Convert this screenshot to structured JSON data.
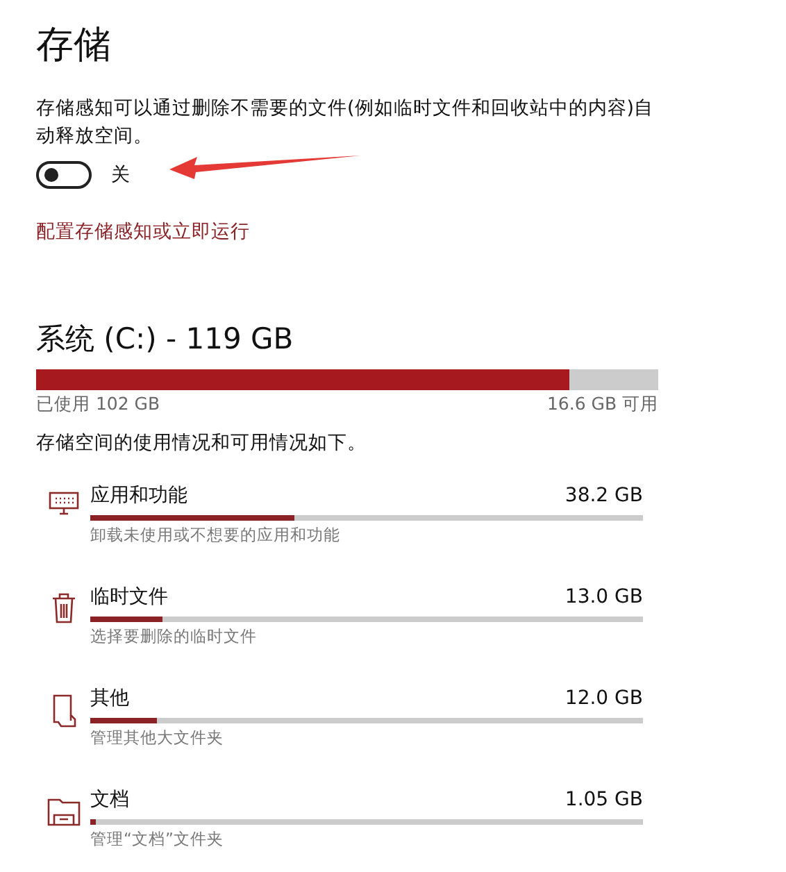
{
  "title": "存储",
  "storage_sense": {
    "description": "存储感知可以通过删除不需要的文件(例如临时文件和回收站中的内容)自动释放空间。",
    "on": false,
    "state_label": "关",
    "link": "配置存储感知或立即运行"
  },
  "drive": {
    "title": "系统 (C:) - 119 GB",
    "level": 0.857,
    "used": "已使用 102 GB",
    "free": "16.6 GB 可用",
    "description": "存储空间的使用情况和可用情况如下。"
  },
  "categories": [
    {
      "kind": "apps",
      "name": "应用和功能",
      "size": "38.2 GB",
      "level": 0.37,
      "hint": "卸载未使用或不想要的应用和功能"
    },
    {
      "kind": "temp",
      "name": "临时文件",
      "size": "13.0 GB",
      "level": 0.13,
      "hint": "选择要删除的临时文件"
    },
    {
      "kind": "other",
      "name": "其他",
      "size": "12.0 GB",
      "level": 0.12,
      "hint": "管理其他大文件夹"
    },
    {
      "kind": "documents",
      "name": "文档",
      "size": "1.05 GB",
      "level": 0.01,
      "hint": "管理“文档”文件夹"
    }
  ]
}
